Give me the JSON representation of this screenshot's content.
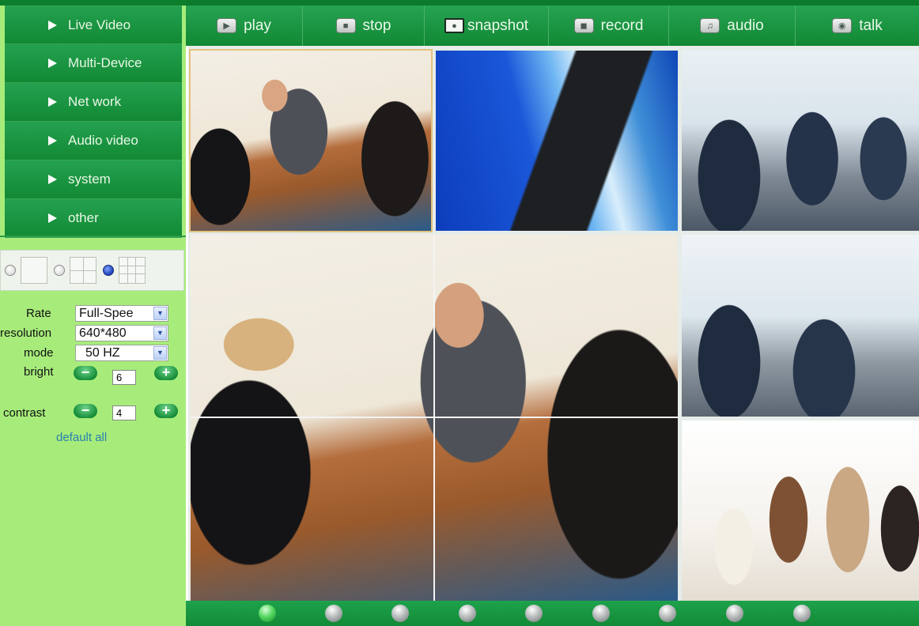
{
  "sidebar": {
    "nav": [
      {
        "label": "Live Video"
      },
      {
        "label": "Multi-Device"
      },
      {
        "label": "Net work"
      },
      {
        "label": "Audio video"
      },
      {
        "label": "system"
      },
      {
        "label": "other"
      }
    ],
    "layout_options": [
      "1-view",
      "4-view",
      "9-view"
    ],
    "layout_selected": "9-view",
    "settings": {
      "rate": {
        "label": "Rate",
        "value": "Full-Spee"
      },
      "resolution": {
        "label": "resolution",
        "value": "640*480"
      },
      "mode": {
        "label": "mode",
        "value": "50 HZ"
      },
      "bright": {
        "label": "bright",
        "value": "6"
      },
      "contrast": {
        "label": "contrast",
        "value": "4"
      },
      "minus_symbol": "−",
      "plus_symbol": "+",
      "default_all": "default all"
    }
  },
  "toolbar": {
    "buttons": [
      {
        "label": "play",
        "icon": "play-icon"
      },
      {
        "label": "stop",
        "icon": "stop-icon"
      },
      {
        "label": "snapshot",
        "icon": "camera-icon"
      },
      {
        "label": "record",
        "icon": "record-icon"
      },
      {
        "label": "audio",
        "icon": "headphones-icon"
      },
      {
        "label": "talk",
        "icon": "microphone-icon"
      }
    ]
  },
  "video": {
    "tiles": [
      {
        "id": 1,
        "content": "photo-meeting"
      },
      {
        "id": 2,
        "content": "photo-businessman-skyscraper"
      },
      {
        "id": 3,
        "content": "photo-conference-room"
      },
      {
        "id": 4,
        "content": "photo-meeting-enlarged"
      },
      {
        "id": 6,
        "content": "photo-conference-room"
      },
      {
        "id": 9,
        "content": "photo-handshake-group"
      }
    ]
  },
  "pager": {
    "count": 9,
    "active_index": 0
  },
  "colors": {
    "nav_green": "#128934",
    "sidebar_bg": "#a7ec7b",
    "link_blue": "#2a7fb0",
    "active_dot": "#55d660"
  }
}
